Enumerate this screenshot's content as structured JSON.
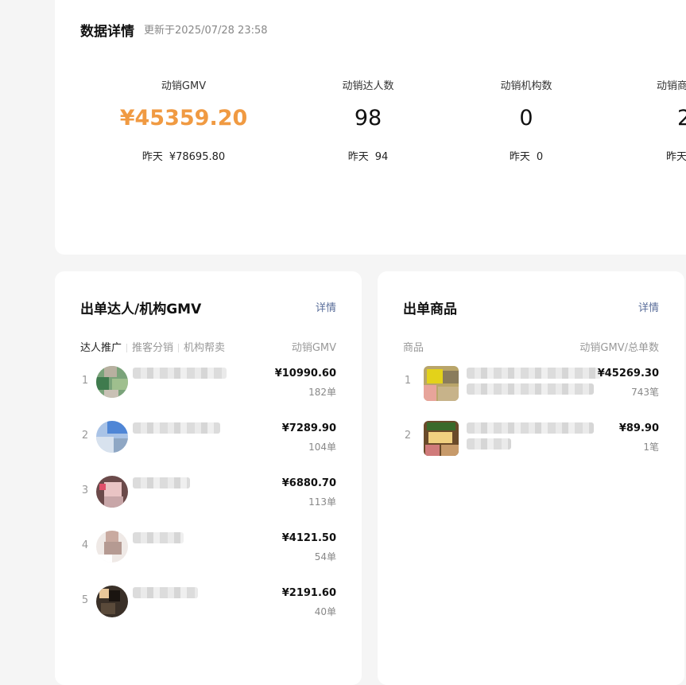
{
  "overview": {
    "title": "数据详情",
    "updated": "更新于2025/07/28 23:58",
    "metrics": [
      {
        "label": "动销GMV",
        "value": "¥45359.20",
        "yesterday_label": "昨天",
        "yesterday_value": "¥78695.80"
      },
      {
        "label": "动销达人数",
        "value": "98",
        "yesterday_label": "昨天",
        "yesterday_value": "94"
      },
      {
        "label": "动销机构数",
        "value": "0",
        "yesterday_label": "昨天",
        "yesterday_value": "0"
      },
      {
        "label": "动销商",
        "value": "2",
        "yesterday_label": "昨天",
        "yesterday_value": ""
      }
    ]
  },
  "creators": {
    "title": "出单达人/机构GMV",
    "detail": "详情",
    "tabs": [
      "达人推广",
      "推客分销",
      "机构帮卖"
    ],
    "column": "动销GMV",
    "rows": [
      {
        "rank": "1",
        "gmv": "¥10990.60",
        "orders": "182单"
      },
      {
        "rank": "2",
        "gmv": "¥7289.90",
        "orders": "104单"
      },
      {
        "rank": "3",
        "gmv": "¥6880.70",
        "orders": "113单"
      },
      {
        "rank": "4",
        "gmv": "¥4121.50",
        "orders": "54单"
      },
      {
        "rank": "5",
        "gmv": "¥2191.60",
        "orders": "40单"
      }
    ]
  },
  "products": {
    "title": "出单商品",
    "detail": "详情",
    "column_left": "商品",
    "column_right": "动销GMV/总单数",
    "rows": [
      {
        "rank": "1",
        "gmv": "¥45269.30",
        "orders": "743笔"
      },
      {
        "rank": "2",
        "gmv": "¥89.90",
        "orders": "1笔"
      }
    ]
  },
  "colors": {
    "accent": "#f09a42",
    "link": "#5a6e9a",
    "background": "#f5f5f5"
  }
}
